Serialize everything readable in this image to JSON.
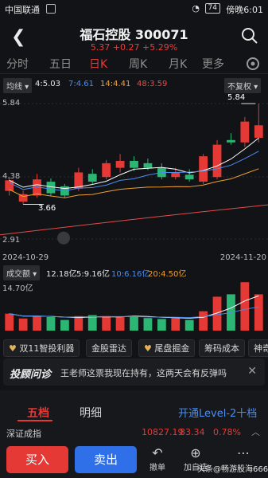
{
  "status": {
    "carrier": "中国联通",
    "right_text": "傍晚6:01",
    "battery": "74"
  },
  "header": {
    "title": "福石控股 300071",
    "quote": "5.37 +0.27 +5.29%"
  },
  "tabs": [
    "分时",
    "五日",
    "日K",
    "周K",
    "月K",
    "更多"
  ],
  "indicator": {
    "ma_dropdown": "均线",
    "ma5": "4:5.03",
    "ma7": "7:4.61",
    "ma14": "14:4.41",
    "ma48": "48:3.59",
    "adjust": "不复权"
  },
  "chart_data": {
    "type": "candlestick",
    "x_start": "2024-10-29",
    "x_end": "2024-11-20",
    "y_ticks": [
      "5.84",
      "4.38",
      "2.91"
    ],
    "high_marker": "5.84",
    "low_marker": "3.66",
    "candles": [
      {
        "o": 3.95,
        "c": 4.18,
        "h": 4.25,
        "l": 3.85
      },
      {
        "o": 3.72,
        "c": 3.88,
        "h": 3.95,
        "l": 3.66
      },
      {
        "o": 3.85,
        "c": 4.2,
        "h": 4.32,
        "l": 3.8
      },
      {
        "o": 4.15,
        "c": 3.9,
        "h": 4.22,
        "l": 3.85
      },
      {
        "o": 4.05,
        "c": 3.85,
        "h": 4.1,
        "l": 3.8
      },
      {
        "o": 4.0,
        "c": 4.35,
        "h": 4.45,
        "l": 3.95
      },
      {
        "o": 4.32,
        "c": 4.15,
        "h": 4.42,
        "l": 4.1
      },
      {
        "o": 4.25,
        "c": 4.55,
        "h": 4.62,
        "l": 4.2
      },
      {
        "o": 4.45,
        "c": 4.6,
        "h": 4.75,
        "l": 4.35
      },
      {
        "o": 4.6,
        "c": 4.45,
        "h": 4.7,
        "l": 4.38
      },
      {
        "o": 4.55,
        "c": 4.45,
        "h": 4.65,
        "l": 4.4
      },
      {
        "o": 4.45,
        "c": 4.25,
        "h": 4.55,
        "l": 4.2
      },
      {
        "o": 4.25,
        "c": 4.35,
        "h": 4.45,
        "l": 4.2
      },
      {
        "o": 4.3,
        "c": 4.2,
        "h": 4.42,
        "l": 4.15
      },
      {
        "o": 4.15,
        "c": 4.7,
        "h": 4.75,
        "l": 4.1
      },
      {
        "o": 4.25,
        "c": 4.95,
        "h": 5.05,
        "l": 4.2
      },
      {
        "o": 5.05,
        "c": 5.0,
        "h": 5.2,
        "l": 4.95
      },
      {
        "o": 5.0,
        "c": 5.45,
        "h": 5.55,
        "l": 4.9
      },
      {
        "o": 5.1,
        "c": 5.37,
        "h": 5.84,
        "l": 5.0
      }
    ],
    "volumes": [
      0.35,
      0.25,
      0.3,
      0.28,
      0.22,
      0.3,
      0.32,
      0.3,
      0.28,
      0.3,
      0.26,
      0.24,
      0.26,
      0.22,
      0.4,
      0.7,
      0.75,
      1.0,
      0.75
    ]
  },
  "volume": {
    "label": "成交额",
    "v1": "12.18亿",
    "v5": "5:9.16亿",
    "v10": "10:6.16亿",
    "v20": "20:4.50亿",
    "max": "14.70亿"
  },
  "tools": [
    "双11智投利器",
    "金股雷达",
    "尾盘掘金",
    "筹码成本",
    "神奇"
  ],
  "advisor": {
    "brand": "投顾问诊",
    "text": "王老师这票我现在持有，这两天会有反弹吗"
  },
  "bottom_tabs": {
    "t1": "五档",
    "t2": "明细",
    "t3": "开通Level-2十档"
  },
  "index_row": {
    "name": "深证成指",
    "value": "10827.19",
    "change": "83.34",
    "pct": "0.78%"
  },
  "actions": {
    "buy": "买入",
    "sell": "卖出",
    "undo": "撤单",
    "add": "加自选",
    "share": "头条@畅游股海666"
  },
  "colors": {
    "up": "#e53935",
    "down": "#2bb673",
    "ma5": "#ffffff",
    "ma7": "#4a8df0",
    "ma14": "#f0a030",
    "ma48": "#e54b4b",
    "buy": "#e53935",
    "sell": "#2f6fe8"
  }
}
